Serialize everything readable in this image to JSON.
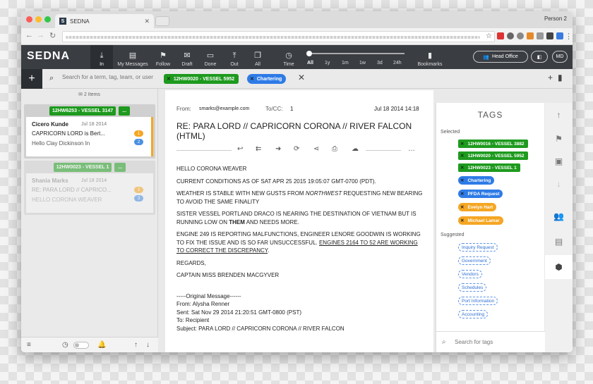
{
  "browser": {
    "tab_title": "SEDNA",
    "tab_favicon": "S",
    "profile": "Person 2"
  },
  "app": {
    "logo": "SEDNA",
    "nav": [
      {
        "label": "In",
        "icon": "download-icon"
      },
      {
        "label": "My Messages",
        "icon": "id-card-icon"
      },
      {
        "label": "Follow",
        "icon": "flag-icon"
      },
      {
        "label": "Draft",
        "icon": "envelope-open-icon"
      },
      {
        "label": "Done",
        "icon": "inbox-icon"
      },
      {
        "label": "Out",
        "icon": "upload-icon"
      },
      {
        "label": "All",
        "icon": "copy-icon"
      },
      {
        "label": "Time",
        "icon": "clock-icon"
      }
    ],
    "time_ranges": [
      "All",
      "1y",
      "1m",
      "1w",
      "3d",
      "24h"
    ],
    "bookmarks_label": "Bookmarks",
    "team": "Head Office",
    "avatar_initials": "MD"
  },
  "search": {
    "placeholder": "Search for a term, tag, team, or user",
    "chips": [
      {
        "label": "12HW0020 - VESSEL 5952",
        "color": "#1e9a1e"
      },
      {
        "label": "Chartering",
        "color": "#2e7be6"
      }
    ]
  },
  "list": {
    "count": "2 Items",
    "threads": [
      {
        "tag": "12HW6253 - VESSEL 3147",
        "more": "...",
        "from": "Cicero Kunde",
        "date": "Jul 18 2014",
        "subject": "CAPRICORN LORD is Bert...",
        "preview": "Hello Clay Dickinson In",
        "badges": [
          "1",
          "2"
        ]
      },
      {
        "tag": "12HW0023 - VESSEL 1",
        "more": "...",
        "from": "Shania Marks",
        "date": "Jul 18 2014",
        "subject": "RE: PARA LORD // CAPRICO...",
        "preview": "HELLO CORONA WEAVER",
        "badges": [
          "2",
          "3"
        ]
      }
    ]
  },
  "email": {
    "from_label": "From:",
    "from": "smarks@example.com",
    "to_label": "To/CC:",
    "to": "1",
    "date": "Jul 18 2014 14:18",
    "subject": "RE: PARA LORD // CAPRICORN CORONA // RIVER FALCON (HTML)",
    "body": {
      "greeting": "HELLO CORONA WEAVER",
      "p1": "CURRENT CONDITIONS AS OF SAT APR 25 2015 19:05:07 GMT-0700 (PDT).",
      "p2_a": "WEATHER IS STABLE WITH NEW GUSTS FROM ",
      "p2_b": "NORTHWEST",
      "p2_c": " REQUESTING NEW BEARING TO AVOID THE SAME FINALITY",
      "p3_a": "SISTER VESSEL PORTLAND DRACO IS NEARING THE DESTINATION OF VIETNAM BUT IS RUNNING LOW ON ",
      "p3_b": "THEM",
      "p3_c": " AND NEEDS MORE.",
      "p4_a": "ENGINE 249 IS REPORTING MALFUNCTIONS, ENGINEER LENORE GOODWIN IS WORKING TO FIX THE ISSUE AND IS SO FAR UNSUCCESSFUL. ",
      "p4_b": "ENGINES 2164 TO 52 ARE WORKING TO CORRECT THE DISCREPANCY",
      "p4_c": ".",
      "regards": "REGARDS,",
      "signature": "CAPTAIN MISS BRENDEN MACGYVER",
      "orig_header": "-----Original Message------",
      "orig_from": "From: Alysha Renner",
      "orig_sent": "Sent: Sat Nov 29 2014 21:20:51 GMT-0800 (PST)",
      "orig_to": "To: Recipient",
      "orig_subject": "Subject: PARA LORD // CAPRICORN CORONA // RIVER FALCON"
    }
  },
  "tags": {
    "title": "TAGS",
    "selected_label": "Selected",
    "selected": [
      {
        "label": "12HW0016 - VESSEL 3882",
        "color": "#1e9a1e"
      },
      {
        "label": "12HW0020 - VESSEL 5952",
        "color": "#1e9a1e"
      },
      {
        "label": "12HW0023 - VESSEL 1",
        "color": "#1e9a1e"
      },
      {
        "label": "Chartering",
        "color": "#2e7be6"
      },
      {
        "label": "PFDA Request",
        "color": "#2e7be6"
      },
      {
        "label": "Evelyn Hart",
        "color": "#f5a623"
      },
      {
        "label": "Michael Lamar",
        "color": "#f5a623"
      }
    ],
    "suggested_label": "Suggested",
    "suggested": [
      "Inquiry Request",
      "Government",
      "Vendors",
      "Schedules",
      "Port Information",
      "Accounting"
    ],
    "search_placeholder": "Search for tags"
  }
}
